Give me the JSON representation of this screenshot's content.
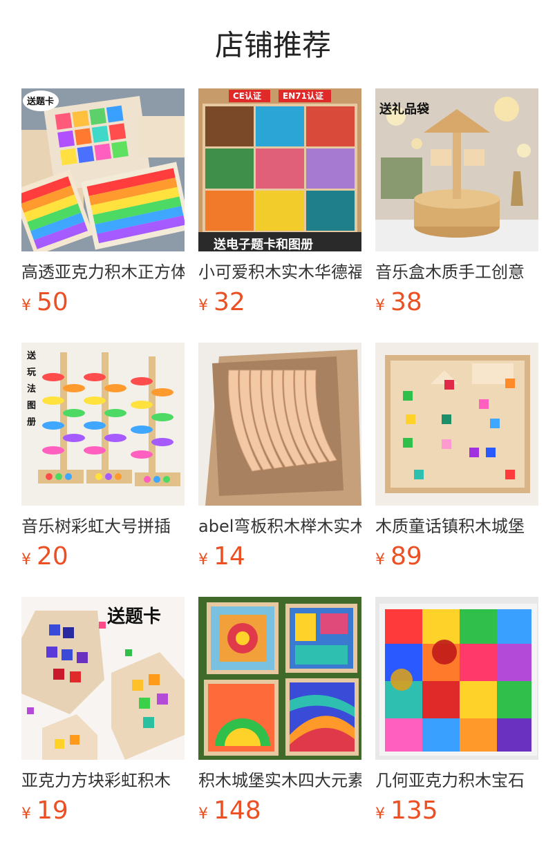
{
  "header": {
    "title": "店铺推荐"
  },
  "products": [
    {
      "name": "高透亚克力积木正方体",
      "currency": "¥",
      "price": "50",
      "badge": "送题卡",
      "icon": "acrylic-cube-blocks"
    },
    {
      "name": "小可爱积木实木华德福",
      "currency": "¥",
      "price": "32",
      "badge": "送电子题卡和图册",
      "badge2": "CE认证",
      "badge3": "EN71认证",
      "icon": "wooden-cone-pieces"
    },
    {
      "name": "音乐盒木质手工创意",
      "currency": "¥",
      "price": "38",
      "badge": "送礼品袋",
      "icon": "carousel-music-box"
    },
    {
      "name": "音乐树彩虹大号拼插",
      "currency": "¥",
      "price": "20",
      "badge": "送玩法图册",
      "icon": "music-tree-toy"
    },
    {
      "name": "abel弯板积木榉木实木",
      "currency": "¥",
      "price": "14",
      "icon": "curved-wood-boards"
    },
    {
      "name": "木质童话镇积木城堡",
      "currency": "¥",
      "price": "89",
      "icon": "wooden-castle-puzzle"
    },
    {
      "name": "亚克力方块彩虹积木",
      "currency": "¥",
      "price": "19",
      "badge": "送题卡",
      "icon": "acrylic-house-blocks"
    },
    {
      "name": "积木城堡实木四大元素",
      "currency": "¥",
      "price": "148",
      "icon": "rainbow-block-boards"
    },
    {
      "name": "几何亚克力积木宝石",
      "currency": "¥",
      "price": "135",
      "icon": "geometric-acrylic-gems"
    }
  ]
}
